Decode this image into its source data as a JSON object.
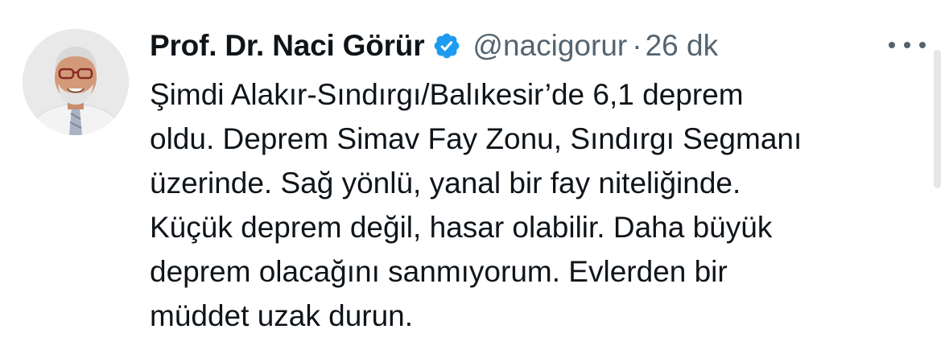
{
  "tweet": {
    "author": {
      "display_name": "Prof. Dr. Naci Görür",
      "handle": "@nacigorur",
      "verified": true
    },
    "separator": "·",
    "time_ago": "26 dk",
    "text_lines": [
      "Şimdi Alakır-Sındırgı/Balıkesir’de 6,1 deprem",
      "oldu. Deprem Simav Fay Zonu, Sındırgı Segmanı",
      "üzerinde. Sağ yönlü, yanal bir fay niteliğinde.",
      "Küçük deprem değil, hasar olabilir. Daha büyük",
      "deprem olacağını sanmıyorum. Evlerden bir",
      "müddet uzak durun."
    ]
  },
  "icons": {
    "verified": "verified-badge-icon",
    "more": "more-horizontal-icon"
  },
  "colors": {
    "primary_text": "#0f1419",
    "secondary_text": "#536471",
    "verified_blue": "#1d9bf0",
    "background": "#ffffff"
  }
}
